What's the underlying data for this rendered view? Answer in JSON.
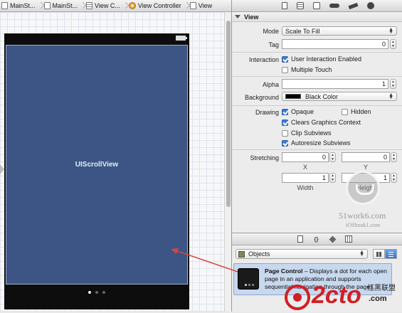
{
  "breadcrumbs": [
    {
      "label": "MainSt...",
      "icon": "file-icon"
    },
    {
      "label": "MainSt...",
      "icon": "file-icon"
    },
    {
      "label": "View C...",
      "icon": "table-icon"
    },
    {
      "label": "View Controller",
      "icon": "view-controller-icon"
    },
    {
      "label": "View",
      "icon": "view-icon"
    }
  ],
  "canvas": {
    "scroll_view_label": "UIScrollView",
    "page_dots": 3,
    "current_page": 1
  },
  "inspector": {
    "toolbar_icons": [
      "file-inspector-icon",
      "quick-help-icon",
      "identity-inspector-icon",
      "attributes-inspector-icon",
      "size-inspector-icon",
      "connections-inspector-icon"
    ],
    "section_title": "View",
    "mode_label": "Mode",
    "mode_value": "Scale To Fill",
    "tag_label": "Tag",
    "tag_value": "0",
    "interaction_label": "Interaction",
    "user_interaction_label": "User Interaction Enabled",
    "user_interaction_checked": true,
    "multiple_touch_label": "Multiple Touch",
    "multiple_touch_checked": false,
    "alpha_label": "Alpha",
    "alpha_value": "1",
    "background_label": "Background",
    "background_value": "Black Color",
    "background_color": "#000000",
    "drawing_label": "Drawing",
    "opaque_label": "Opaque",
    "opaque_checked": true,
    "hidden_label": "Hidden",
    "hidden_checked": false,
    "clears_label": "Clears Graphics Context",
    "clears_checked": true,
    "clip_label": "Clip Subviews",
    "clip_checked": false,
    "autoresize_label": "Autoresize Subviews",
    "autoresize_checked": true,
    "stretching_label": "Stretching",
    "stretch_x": "0",
    "stretch_y": "0",
    "stretch_w": "1",
    "stretch_h": "1",
    "x_label": "X",
    "y_label": "Y",
    "width_label": "Width",
    "height_label": "Height"
  },
  "library": {
    "toolbar_icons": [
      "file-template-icon",
      "code-snippet-icon",
      "object-library-icon",
      "media-library-icon"
    ],
    "filter_value": "Objects",
    "item": {
      "title": "Page Control",
      "description": " – Displays a dot for each open page in an application and supports sequential navigation through the pages."
    }
  },
  "watermarks": {
    "site1": "51work6.com",
    "site2": "iOSbook1.com",
    "logo_text": "2cto",
    "logo_sub": ".com",
    "logo_cn": "红黑联盟"
  },
  "colors": {
    "scroll_view": "#3c5585",
    "accent": "#3d7bd9",
    "arrow": "#d9453f",
    "logo_red": "#d11f25"
  }
}
